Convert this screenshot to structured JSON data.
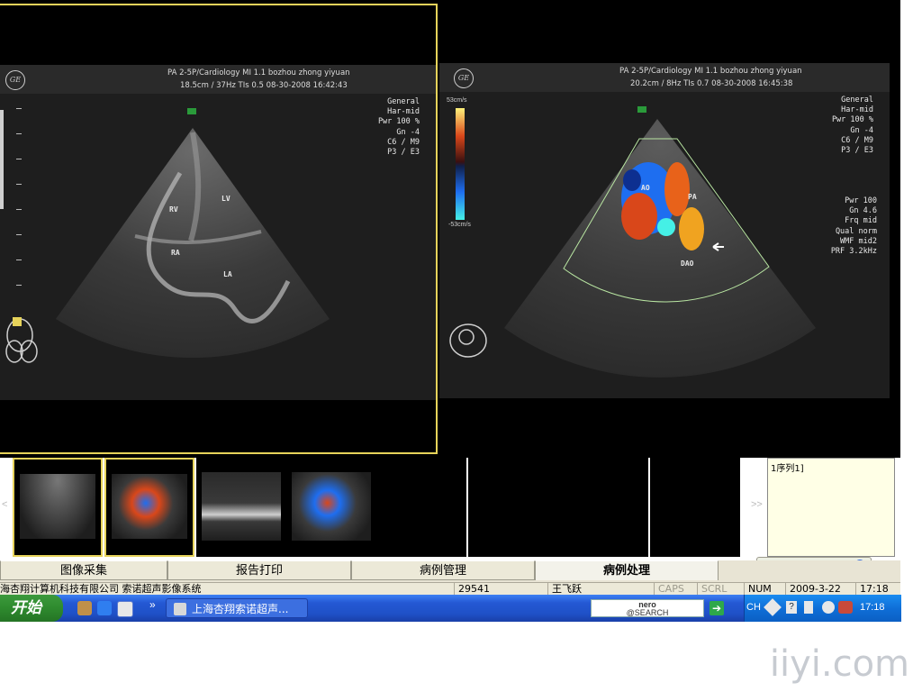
{
  "left_pane": {
    "header_row1": "PA 2-5P/Cardiology   MI 1.1   bozhou zhong yiyuan",
    "header_row2": "18.5cm / 37Hz    TIs 0.5    08-30-2008 16:42:43",
    "logo": "GE",
    "params": "General\nHar-mid\nPwr 100 %\nGn -4\nC6 / M9\nP3 / E3",
    "labels": {
      "rv": "RV",
      "lv": "LV",
      "ra": "RA",
      "la": "LA"
    }
  },
  "right_pane": {
    "header_row1": "PA 2-5P/Cardiology   MI 1.1   bozhou zhong yiyuan",
    "header_row2": "20.2cm / 8Hz    TIs 0.7    08-30-2008 16:45:38",
    "logo": "GE",
    "params": "General\nHar-mid\nPwr 100 %\nGn -4\nC6 / M9\nP3 / E3",
    "params2": [
      "Pwr 100",
      "Gn 4.6",
      "Frq mid",
      "Qual norm",
      "WMF mid2",
      "PRF 3.2kHz"
    ],
    "color_scale": {
      "top": "53cm/s",
      "bottom": "-53cm/s"
    },
    "labels": {
      "ao": "AO",
      "pa": "PA",
      "dao": "DAO"
    }
  },
  "thumbnails": {
    "prev_arrow": "<",
    "next_arrow": ">>"
  },
  "series_box": {
    "text": "1序列1]"
  },
  "tabs": [
    {
      "label": "图像采集",
      "active": false
    },
    {
      "label": "报告打印",
      "active": false
    },
    {
      "label": "病例管理",
      "active": false
    },
    {
      "label": "病例处理",
      "active": true
    }
  ],
  "status_bar": {
    "company": "海杏翔计算机科技有限公司 索诺超声影像系统",
    "number": "29541",
    "user": "王飞跃",
    "caps": "CAPS",
    "scrl": "SCRL",
    "num": "NUM",
    "date": "2009-3-22",
    "time": "17:18"
  },
  "taskbar": {
    "start_label": "开始",
    "overflow": "»",
    "task_label": "上海杏翔索诺超声...",
    "nero_line1": "nero",
    "nero_line2": "@SEARCH",
    "tray_lang": "CH",
    "tray_time": "17:18"
  },
  "watermark": "iiyi.com",
  "colors": {
    "selection": "#e6d35a",
    "taskbar": "#245edb",
    "start": "#2e8a2e"
  }
}
